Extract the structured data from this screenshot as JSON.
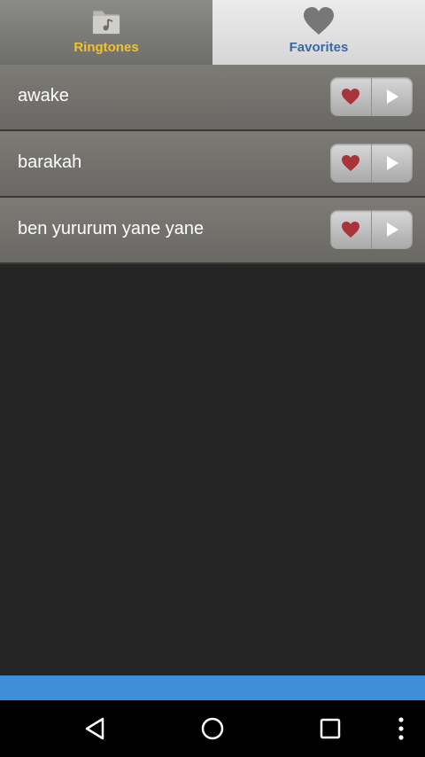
{
  "tabs": [
    {
      "label": "Ringtones",
      "icon": "folder-music-icon"
    },
    {
      "label": "Favorites",
      "icon": "heart-icon"
    }
  ],
  "ringtones": [
    {
      "title": "awake"
    },
    {
      "title": "barakah"
    },
    {
      "title": "ben yururum yane yane"
    }
  ],
  "colors": {
    "ringtones_label": "#f2c32a",
    "favorites_label": "#3a67a8",
    "heart": "#a8343b",
    "accent_bar": "#3e8fd8"
  },
  "navbar": {
    "icons": [
      "back-icon",
      "home-icon",
      "recents-icon",
      "more-icon"
    ]
  }
}
